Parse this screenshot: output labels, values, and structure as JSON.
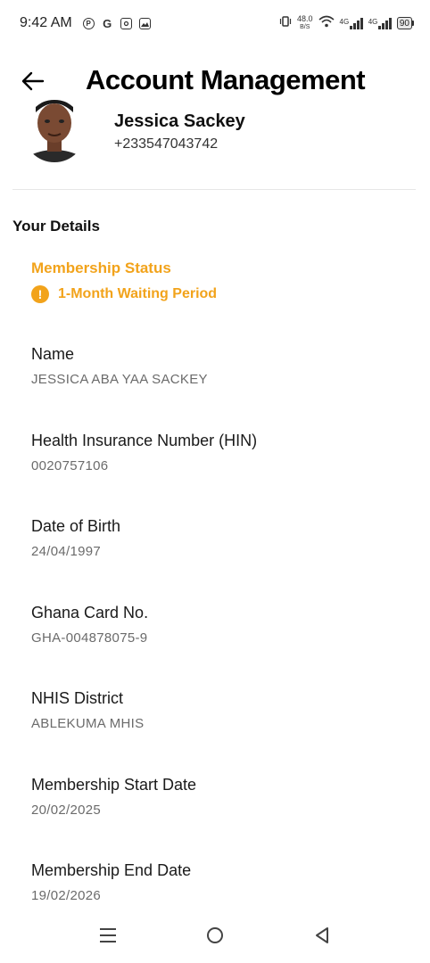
{
  "status_bar": {
    "time": "9:42 AM",
    "notification_icons": [
      "pinterest-icon",
      "g-icon",
      "instagram-icon",
      "gallery-icon"
    ],
    "net_speed_value": "48.0",
    "net_speed_unit": "B/S",
    "network_1": "4G",
    "network_2": "4G",
    "battery": "90"
  },
  "header": {
    "title": "Account Management"
  },
  "profile": {
    "name": "Jessica Sackey",
    "phone": "+233547043742"
  },
  "details": {
    "section_title": "Your Details",
    "membership_label": "Membership Status",
    "membership_status": "1-Month Waiting Period",
    "fields": [
      {
        "label": "Name",
        "value": "JESSICA ABA YAA SACKEY"
      },
      {
        "label": "Health Insurance Number (HIN)",
        "value": "0020757106"
      },
      {
        "label": "Date of Birth",
        "value": "24/04/1997"
      },
      {
        "label": "Ghana Card No.",
        "value": "GHA-004878075-9"
      },
      {
        "label": "NHIS District",
        "value": "ABLEKUMA MHIS"
      },
      {
        "label": "Membership Start Date",
        "value": "20/02/2025"
      },
      {
        "label": "Membership End Date",
        "value": "19/02/2026"
      }
    ]
  },
  "colors": {
    "accent": "#F2A31B",
    "text": "#111111",
    "muted": "#6b6b6b",
    "divider": "#e6e6e6"
  }
}
